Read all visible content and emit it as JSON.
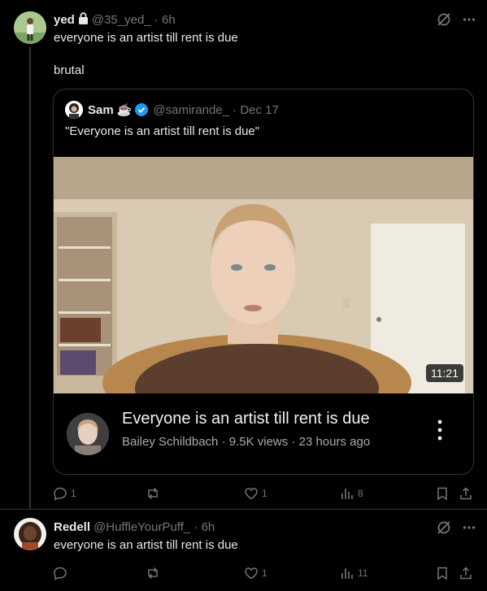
{
  "post1": {
    "display_name": "yed",
    "handle": "@35_yed_",
    "time": "6h",
    "text_line1": "everyone is an artist till rent is due",
    "text_line2": "brutal",
    "quote": {
      "display_name": "Sam",
      "emoji": "☕",
      "handle": "@samirande_",
      "date": "Dec 17",
      "text": "\"Everyone is an artist till rent is due\"",
      "video": {
        "duration": "11:21",
        "title": "Everyone is an artist till rent is due",
        "meta": "Bailey Schildbach · 9.5K views · 23 hours ago"
      }
    },
    "actions": {
      "replies": "1",
      "reposts": "",
      "likes": "1",
      "views": "8"
    }
  },
  "post2": {
    "display_name": "Redell",
    "handle": "@HuffleYourPuff_",
    "time": "6h",
    "text": "everyone is an artist till rent is due",
    "actions": {
      "replies": "",
      "reposts": "",
      "likes": "1",
      "views": "11"
    }
  },
  "colors": {
    "background": "#000000",
    "text": "#e7e9ea",
    "muted": "#71767b",
    "verified": "#1d9bf0",
    "border": "#2f3336"
  }
}
